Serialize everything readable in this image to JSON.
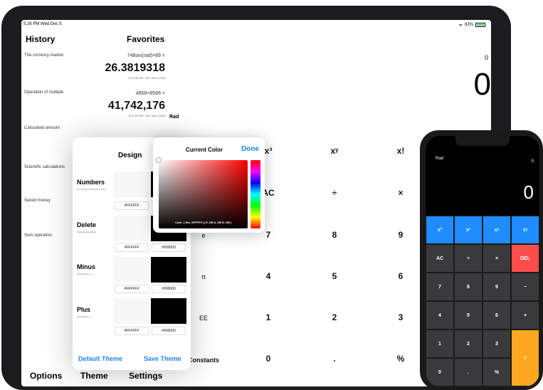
{
  "status": {
    "time": "5:26 PM  Wed Dec 5",
    "battery": "82%"
  },
  "history_title": "History",
  "favorites_title": "Favorites",
  "history": [
    {
      "category": "The currency market",
      "expr": "748sin(rad)×89 =",
      "result": "26.3819318",
      "stamp": "5:21:36 PM - 05 / Dec / 2018"
    },
    {
      "category": "Operation of multiple",
      "expr": "4858×8596 =",
      "result": "41,742,176",
      "stamp": "5:21:51 PM - 05 / Dec / 2018"
    }
  ],
  "categories_more": [
    "Calculated amount",
    "Scientific calculations",
    "Saved money",
    "Sum operation"
  ],
  "display": {
    "small": "0",
    "big": "0",
    "mode": "Rad"
  },
  "keys": {
    "row1": [
      "x³",
      "xʸ",
      "x!"
    ],
    "row2": [
      "AC",
      "÷",
      "×"
    ],
    "row3": [
      "e",
      "7",
      "8",
      "9"
    ],
    "row4": [
      "π",
      "4",
      "5",
      "6"
    ],
    "row5": [
      "EE",
      "1",
      "2",
      "3"
    ],
    "row6": [
      "Constants",
      "0",
      ".",
      "%"
    ]
  },
  "nav": {
    "options": "Options",
    "theme": "Theme",
    "settings": "Settings"
  },
  "theme_popover": {
    "title": "Design",
    "rows": [
      {
        "label": "Numbers",
        "sub": "0,1,2,3,4,5,6,7,8,9,A,B,C,D,E,F",
        "hex_light": "#FFFFFF",
        "hex_dark": ""
      },
      {
        "label": "Delete",
        "sub": "Delete Button (DEL)",
        "hex_light": "#FFFFFF",
        "hex_dark": "#000000"
      },
      {
        "label": "Minus",
        "sub": "Minus Button ( - )",
        "hex_light": "#FFFFFF",
        "hex_dark": "#000000"
      },
      {
        "label": "Plus",
        "sub": "Plus Button ( + )",
        "hex_light": "#FFFFFF",
        "hex_dark": "#000000"
      }
    ],
    "default_theme": "Default Theme",
    "save_theme": "Save Theme"
  },
  "color_popover": {
    "title": "Current Color",
    "done": "Done",
    "caption": "Color : [ Hex: #FFFFFF ] [ R: 255 G: 255 B: 255 ]"
  },
  "iphone": {
    "mode": "Rad",
    "small": "0",
    "big": "0",
    "rows": [
      [
        {
          "t": "x²",
          "c": "#1f8cff"
        },
        {
          "t": "x³",
          "c": "#1f8cff"
        },
        {
          "t": "xʸ",
          "c": "#1f8cff"
        },
        {
          "t": "x!",
          "c": "#1f8cff"
        }
      ],
      [
        {
          "t": "AC",
          "c": "#3a3a3c"
        },
        {
          "t": "÷",
          "c": "#3a3a3c"
        },
        {
          "t": "×",
          "c": "#3a3a3c"
        },
        {
          "t": "DEL",
          "c": "#ff4d4d"
        }
      ],
      [
        {
          "t": "7",
          "c": "#3a3a3c"
        },
        {
          "t": "8",
          "c": "#3a3a3c"
        },
        {
          "t": "9",
          "c": "#3a3a3c"
        },
        {
          "t": "−",
          "c": "#3a3a3c"
        }
      ],
      [
        {
          "t": "4",
          "c": "#3a3a3c"
        },
        {
          "t": "5",
          "c": "#3a3a3c"
        },
        {
          "t": "6",
          "c": "#3a3a3c"
        },
        {
          "t": "+",
          "c": "#3a3a3c"
        }
      ],
      [
        {
          "t": "1",
          "c": "#3a3a3c"
        },
        {
          "t": "2",
          "c": "#3a3a3c"
        },
        {
          "t": "3",
          "c": "#3a3a3c"
        },
        {
          "t": "=",
          "c": "#ffa81f"
        }
      ],
      [
        {
          "t": "0",
          "c": "#3a3a3c"
        },
        {
          "t": ".",
          "c": "#3a3a3c"
        },
        {
          "t": "%",
          "c": "#3a3a3c"
        }
      ]
    ]
  },
  "colors": {
    "accent": "#1a84ff",
    "equals": "#ffa81f",
    "delete": "#ff4d4d",
    "sci": "#1f8cff"
  }
}
